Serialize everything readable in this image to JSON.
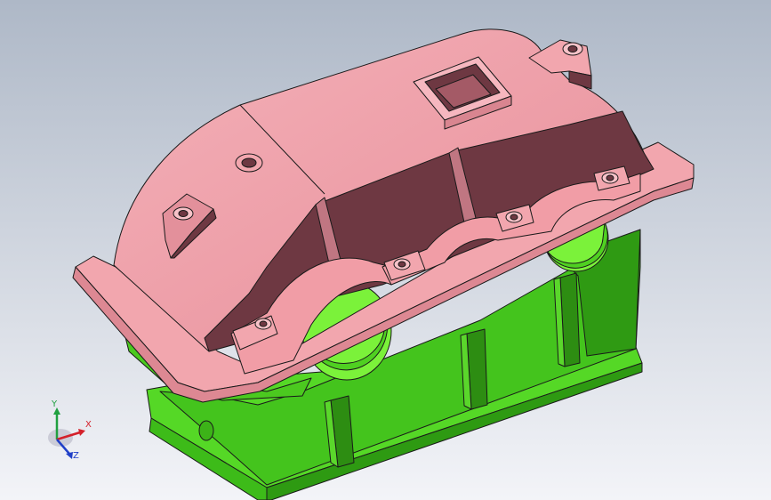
{
  "viewport": {
    "background_top": "#aeb8c7",
    "background_bottom": "#f3f4f8"
  },
  "model": {
    "cover_color": "#ee9aa3",
    "cover_shadow_color": "#6e3842",
    "base_color": "#47c81e",
    "base_highlight_color": "#7bf23a",
    "edge_color": "#1a1a1a"
  },
  "triad": {
    "x_label": "X",
    "y_label": "Y",
    "z_label": "Z",
    "x_color": "#d4202a",
    "y_color": "#20a040",
    "z_color": "#2040c8"
  }
}
